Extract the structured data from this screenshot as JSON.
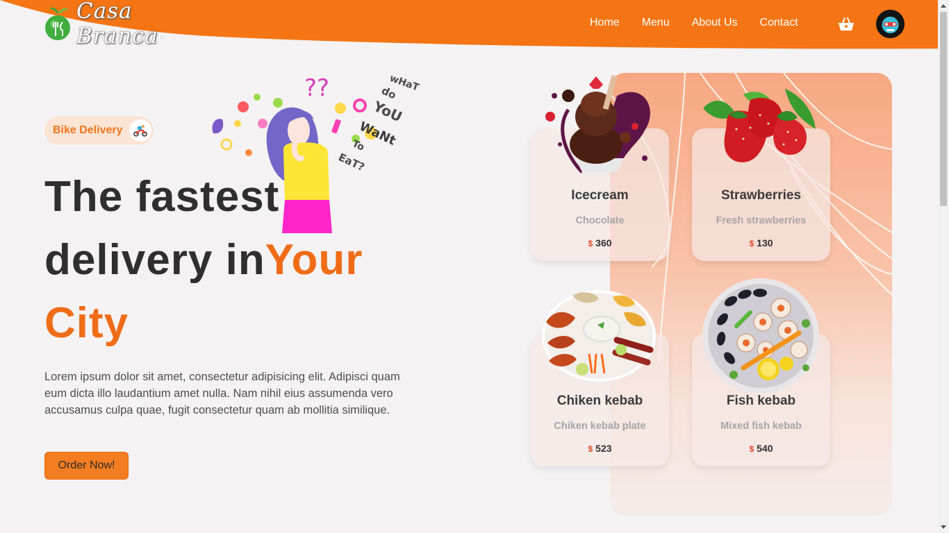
{
  "brand": {
    "name": "Casa Branca",
    "accent": "#f57d21"
  },
  "nav": {
    "items": [
      "Home",
      "Menu",
      "About Us",
      "Contact"
    ],
    "cart_icon": "cart-icon",
    "avatar_icon": "avatar"
  },
  "hero": {
    "badge": "Bike Delivery",
    "headline_line1": "The fastest",
    "headline_line2": "delivery in",
    "headline_accent1": "Your",
    "headline_accent2": "City",
    "description": "Lorem ipsum dolor sit amet, consectetur adipisicing elit. Adipisci quam eum dicta illo laudantium amet nulla. Nam nihil eius assumenda vero accusamus culpa quae, fugit consectetur quam ab mollitia similique.",
    "cta": "Order Now!",
    "illustration_words": [
      "wHaT",
      "do",
      "YoU",
      "WaNt",
      "To",
      "EaT?"
    ]
  },
  "menu": {
    "currency": "$",
    "items": [
      {
        "title": "Icecream",
        "subtitle": "Chocolate",
        "price": "360"
      },
      {
        "title": "Strawberries",
        "subtitle": "Fresh strawberries",
        "price": "130"
      },
      {
        "title": "Chiken kebab",
        "subtitle": "Chiken kebab plate",
        "price": "523"
      },
      {
        "title": "Fish kebab",
        "subtitle": "Mixed fish kebab",
        "price": "540"
      }
    ]
  }
}
